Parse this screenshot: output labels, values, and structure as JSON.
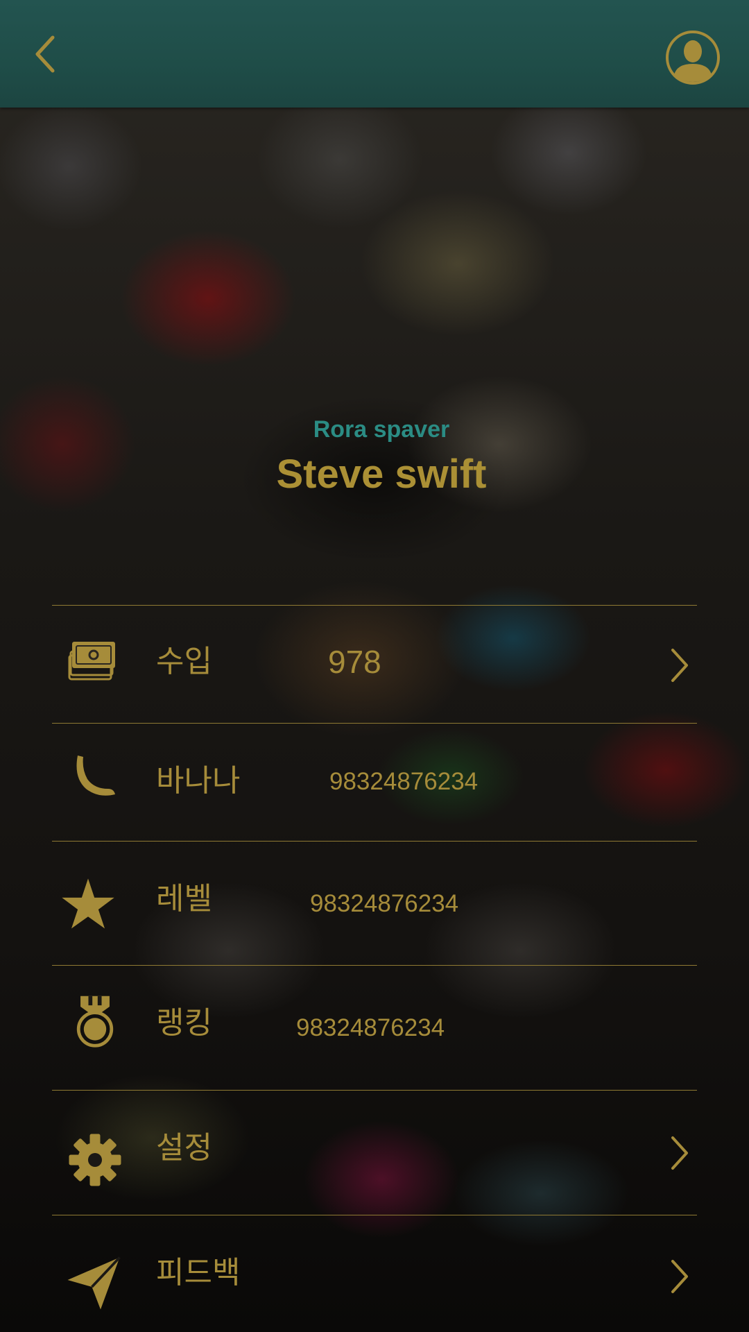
{
  "topbar": {
    "back_icon": "chevron-left-icon",
    "profile_icon": "user-avatar-icon"
  },
  "profile": {
    "subtitle": "Rora spaver",
    "name": "Steve swift"
  },
  "menu": {
    "items": [
      {
        "icon": "money-icon",
        "label": "수입",
        "value": "978",
        "has_chevron": true
      },
      {
        "icon": "banana-icon",
        "label": "바나나",
        "value": "98324876234",
        "has_chevron": false
      },
      {
        "icon": "star-icon",
        "label": "레벨",
        "value": "98324876234",
        "has_chevron": false
      },
      {
        "icon": "medal-icon",
        "label": "랭킹",
        "value": "98324876234",
        "has_chevron": false
      },
      {
        "icon": "gear-icon",
        "label": "설정",
        "value": "",
        "has_chevron": true
      },
      {
        "icon": "paper-plane-icon",
        "label": "피드백",
        "value": "",
        "has_chevron": true
      }
    ]
  },
  "colors": {
    "accent_gold": "#a68c3a",
    "accent_teal": "#2b8c84",
    "topbar": "#235450",
    "divider": "#8f7a33"
  }
}
